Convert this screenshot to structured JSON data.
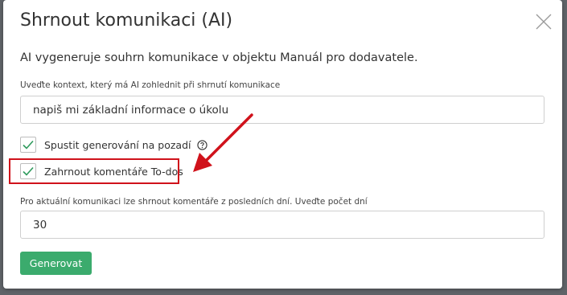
{
  "dialog": {
    "title": "Shrnout komunikaci (AI)",
    "description": "AI vygeneruje souhrn komunikace v objektu Manuál pro dodavatele."
  },
  "context_field": {
    "label": "Uveďte kontext, který má AI zohlednit při shrnutí komunikace",
    "value": "napiš mi základní informace o úkolu"
  },
  "options": {
    "background": {
      "label": "Spustit generování na pozadí",
      "checked": true
    },
    "todos": {
      "label": "Zahrnout komentáře To-dos",
      "checked": true
    }
  },
  "days_field": {
    "label": "Pro aktuální komunikaci lze shrnout komentáře z posledních dní. Uveďte počet dní",
    "value": "30"
  },
  "actions": {
    "generate_label": "Generovat"
  },
  "icons": {
    "close": "close-icon",
    "check": "checkmark-icon",
    "help": "question-circle-icon",
    "arrow": "annotation-arrow"
  },
  "colors": {
    "primary": "#3bab6d",
    "check": "#2e9a5c",
    "annotation": "#d0121b"
  }
}
